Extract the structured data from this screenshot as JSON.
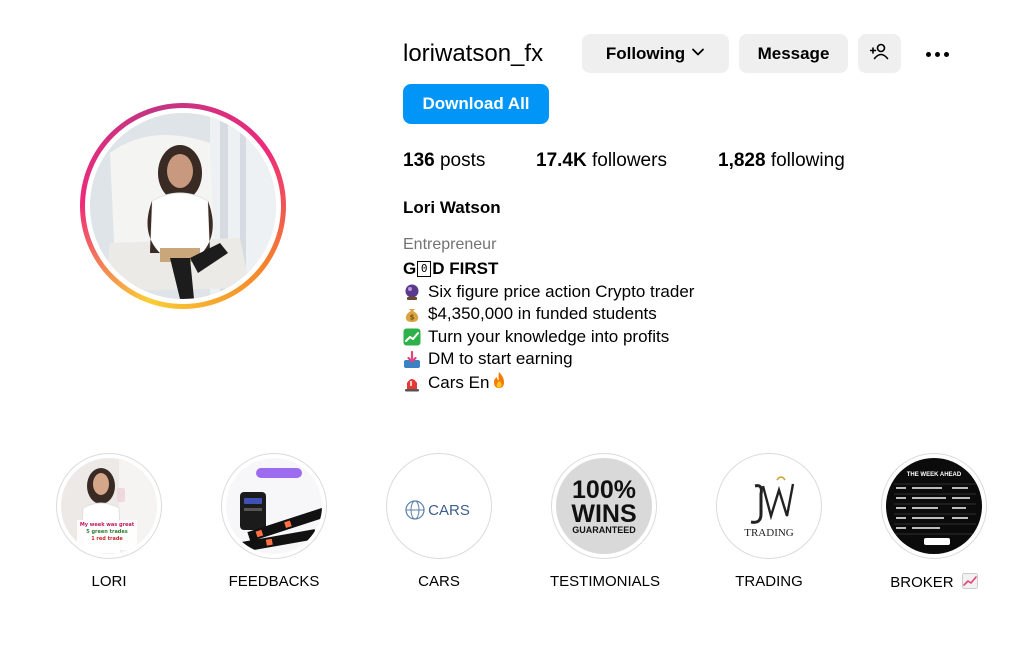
{
  "profile": {
    "username": "loriwatson_fx",
    "following_label": "Following",
    "message_label": "Message",
    "download_label": "Download All",
    "full_name": "Lori Watson",
    "category": "Entrepreneur"
  },
  "stats": {
    "posts_count": "136",
    "posts_label": "posts",
    "followers_count": "17.4K",
    "followers_label": "followers",
    "following_count": "1,828",
    "following_label": "following"
  },
  "bio": {
    "title_a": "G",
    "title_box": "0",
    "title_b": "D FIRST",
    "lines": [
      {
        "icon": "crystal-ball-icon",
        "text": "Six figure price action Crypto trader"
      },
      {
        "icon": "money-bag-icon",
        "text": "$4,350,000 in funded students"
      },
      {
        "icon": "chart-up-icon",
        "text": "Turn your knowledge into profits"
      },
      {
        "icon": "inbox-icon",
        "text": "DM to start earning"
      },
      {
        "icon": "siren-icon",
        "text": "Cars En",
        "suffix_icon": "fire-icon"
      }
    ]
  },
  "highlights": [
    {
      "label": "LORI"
    },
    {
      "label": "FEEDBACKS"
    },
    {
      "label": "CARS",
      "image_text": "CARS"
    },
    {
      "label": "TESTIMONIALS",
      "image_text_1": "100%",
      "image_text_2": "WINS",
      "image_text_3": "GUARANTEED"
    },
    {
      "label": "TRADING",
      "image_text": "TRADING"
    },
    {
      "label": "BROKER",
      "image_text": "THE WEEK AHEAD",
      "label_icon": "chart-up-icon"
    }
  ],
  "colors": {
    "accent": "#0095f6",
    "button_gray": "#efefef",
    "muted_text": "#737373",
    "ring_gradient": [
      "#f9ce34",
      "#ee2a7b",
      "#c13584"
    ]
  }
}
